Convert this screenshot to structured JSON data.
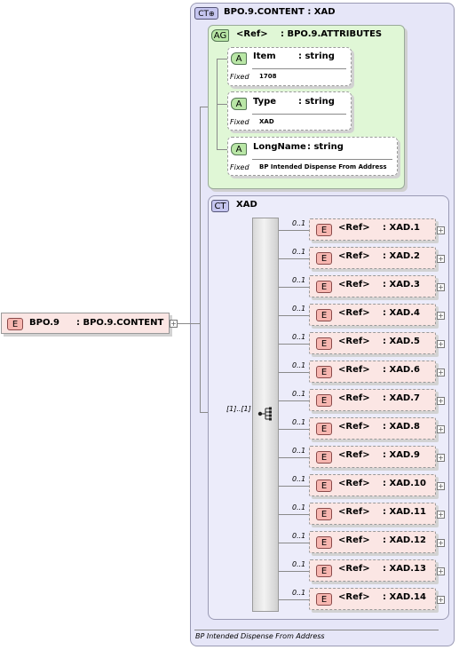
{
  "root": {
    "kind": "E",
    "name": "BPO.9",
    "type": ": BPO.9.CONTENT"
  },
  "content_type": {
    "kind": "CT",
    "title": "BPO.9.CONTENT : XAD",
    "footer": "BP Intended Dispense From Address"
  },
  "attribute_group": {
    "kind": "AG",
    "ref": "<Ref>",
    "name": ": BPO.9.ATTRIBUTES",
    "fixed_label": "Fixed",
    "attributes": [
      {
        "kind": "A",
        "name": "Item",
        "type": ": string",
        "fixed": "1708"
      },
      {
        "kind": "A",
        "name": "Type",
        "type": ": string",
        "fixed": "XAD"
      },
      {
        "kind": "A",
        "name": "LongName",
        "type": ": string",
        "fixed": "BP Intended Dispense From Address"
      }
    ]
  },
  "inner_type": {
    "kind": "CT",
    "name": "XAD"
  },
  "sequence": {
    "occurrence": "[1]..[1]"
  },
  "elements": [
    {
      "occ": "0..1",
      "kind": "E",
      "ref": "<Ref>",
      "name": ": XAD.1"
    },
    {
      "occ": "0..1",
      "kind": "E",
      "ref": "<Ref>",
      "name": ": XAD.2"
    },
    {
      "occ": "0..1",
      "kind": "E",
      "ref": "<Ref>",
      "name": ": XAD.3"
    },
    {
      "occ": "0..1",
      "kind": "E",
      "ref": "<Ref>",
      "name": ": XAD.4"
    },
    {
      "occ": "0..1",
      "kind": "E",
      "ref": "<Ref>",
      "name": ": XAD.5"
    },
    {
      "occ": "0..1",
      "kind": "E",
      "ref": "<Ref>",
      "name": ": XAD.6"
    },
    {
      "occ": "0..1",
      "kind": "E",
      "ref": "<Ref>",
      "name": ": XAD.7"
    },
    {
      "occ": "0..1",
      "kind": "E",
      "ref": "<Ref>",
      "name": ": XAD.8"
    },
    {
      "occ": "0..1",
      "kind": "E",
      "ref": "<Ref>",
      "name": ": XAD.9"
    },
    {
      "occ": "0..1",
      "kind": "E",
      "ref": "<Ref>",
      "name": ": XAD.10"
    },
    {
      "occ": "0..1",
      "kind": "E",
      "ref": "<Ref>",
      "name": ": XAD.11"
    },
    {
      "occ": "0..1",
      "kind": "E",
      "ref": "<Ref>",
      "name": ": XAD.12"
    },
    {
      "occ": "0..1",
      "kind": "E",
      "ref": "<Ref>",
      "name": ": XAD.13"
    },
    {
      "occ": "0..1",
      "kind": "E",
      "ref": "<Ref>",
      "name": ": XAD.14"
    }
  ],
  "expand_symbol": "+"
}
